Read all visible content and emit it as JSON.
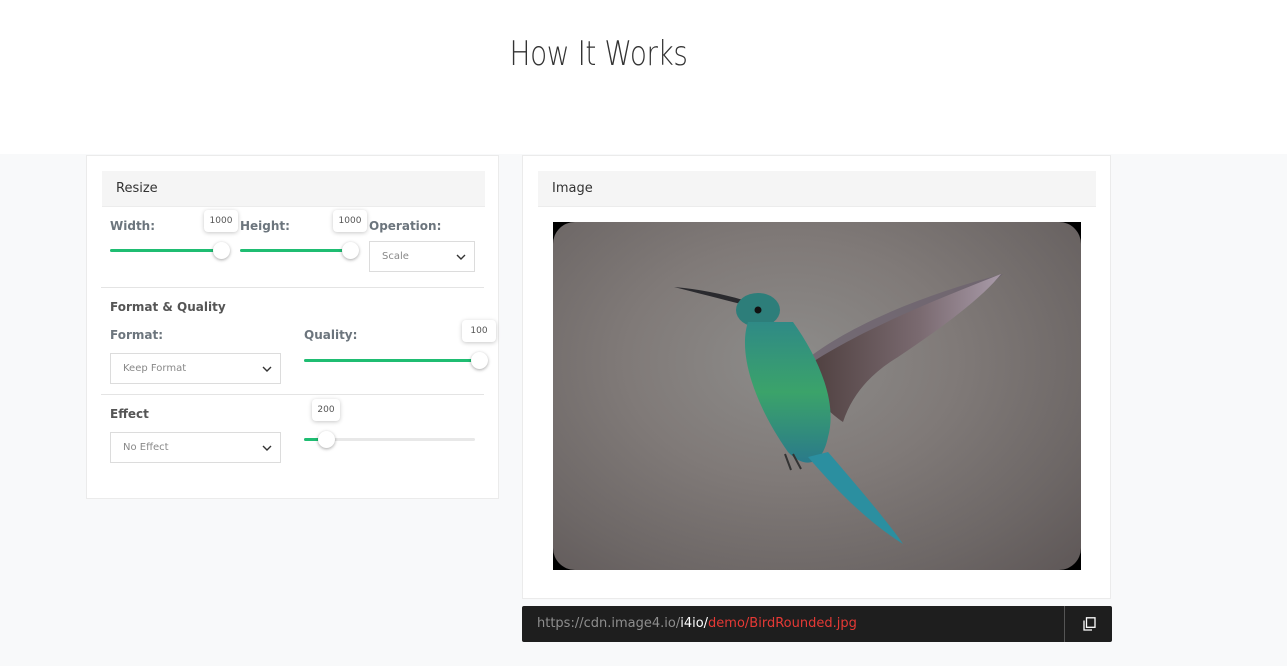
{
  "page": {
    "title": "How It Works"
  },
  "resize": {
    "header": "Resize",
    "width": {
      "label": "Width:",
      "value": "1000",
      "fraction": 0.87
    },
    "height": {
      "label": "Height:",
      "value": "1000",
      "fraction": 0.87
    },
    "operation": {
      "label": "Operation:",
      "selected": "Scale"
    }
  },
  "format_quality": {
    "section_title": "Format & Quality",
    "format": {
      "label": "Format:",
      "selected": "Keep Format"
    },
    "quality": {
      "label": "Quality:",
      "value": "100",
      "fraction": 1.0
    }
  },
  "effect": {
    "section_title": "Effect",
    "selected": "No Effect",
    "amount": {
      "value": "200",
      "fraction": 0.13
    }
  },
  "image_panel": {
    "header": "Image",
    "alt": "Hummingbird"
  },
  "url": {
    "base": "https://cdn.image4.io/",
    "account": "i4io/",
    "path": "demo/BirdRounded.jpg"
  },
  "icons": {
    "copy": "copy-icon",
    "select_arrow": "chevron-down-icon"
  },
  "colors": {
    "slider_fill": "#1fbd72",
    "url_path": "#e53935",
    "url_bg": "#1e1e1e"
  }
}
